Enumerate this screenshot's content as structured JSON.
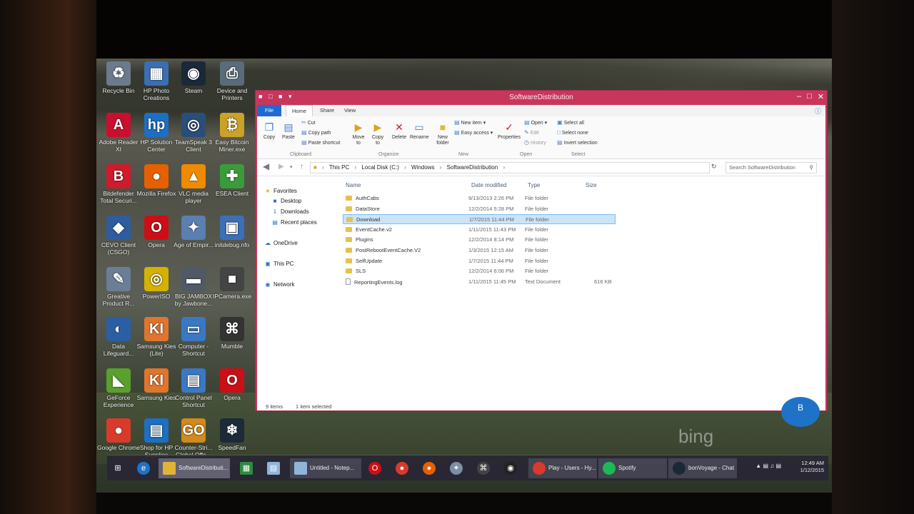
{
  "desktop": {
    "icons": [
      {
        "label": "Recycle Bin",
        "glyph": "♻",
        "color": "#6b7b8c"
      },
      {
        "label": "HP Photo Creations",
        "glyph": "▦",
        "color": "#3b6fb3"
      },
      {
        "label": "Steam",
        "glyph": "◉",
        "color": "#1b2838"
      },
      {
        "label": "Device and Printers",
        "glyph": "⎙",
        "color": "#5a6b7c"
      },
      {
        "label": "Adobe Reader XI",
        "glyph": "A",
        "color": "#c8102e"
      },
      {
        "label": "HP Solution Center",
        "glyph": "hp",
        "color": "#1d6fc2"
      },
      {
        "label": "TeamSpeak 3 Client",
        "glyph": "◎",
        "color": "#2a4e7a"
      },
      {
        "label": "Easy Bitcoin Miner.exe",
        "glyph": "₿",
        "color": "#c9a227"
      },
      {
        "label": "Bitdefender Total Securi...",
        "glyph": "B",
        "color": "#cf1b2b"
      },
      {
        "label": "Mozilla Firefox",
        "glyph": "●",
        "color": "#e66000"
      },
      {
        "label": "VLC media player",
        "glyph": "▲",
        "color": "#f08a00"
      },
      {
        "label": "ESEA Client",
        "glyph": "✚",
        "color": "#3a9b3a"
      },
      {
        "label": "CEVO Client (CSGO)",
        "glyph": "◆",
        "color": "#2f5c9e"
      },
      {
        "label": "Opera",
        "glyph": "O",
        "color": "#cc0f16"
      },
      {
        "label": "Age of Empir...",
        "glyph": "✦",
        "color": "#5a7fb0"
      },
      {
        "label": "initdebug.nfo",
        "glyph": "▣",
        "color": "#3c6fb8"
      },
      {
        "label": "Greative Product R...",
        "glyph": "✎",
        "color": "#6a7e95"
      },
      {
        "label": "PowerISO",
        "glyph": "◎",
        "color": "#d4b200"
      },
      {
        "label": "BIG JAMBOX by Jawbone...",
        "glyph": "▬",
        "color": "#505a66"
      },
      {
        "label": "IPCamera.exe",
        "glyph": "■",
        "color": "#444"
      },
      {
        "label": "Data Lifeguard...",
        "glyph": "◐",
        "color": "#2b5fa3"
      },
      {
        "label": "Samsung Kies (Lite)",
        "glyph": "KI",
        "color": "#e0752e"
      },
      {
        "label": "Computer - Shortcut",
        "glyph": "▭",
        "color": "#3b78c4"
      },
      {
        "label": "Mumble",
        "glyph": "⌘",
        "color": "#333"
      },
      {
        "label": "GeForce Experience",
        "glyph": "◣",
        "color": "#5aa02c"
      },
      {
        "label": "Samsung Kies",
        "glyph": "KI",
        "color": "#e0752e"
      },
      {
        "label": "Control Panel Shortcut",
        "glyph": "▤",
        "color": "#3b78c4"
      },
      {
        "label": "Opera",
        "glyph": "O",
        "color": "#cc0f16"
      },
      {
        "label": "Google Chrome",
        "glyph": "●",
        "color": "#d83b2b"
      },
      {
        "label": "Shop for HP Supplies",
        "glyph": "▤",
        "color": "#1d6fc2"
      },
      {
        "label": "Counter-Stri... Global Offe...",
        "glyph": "GO",
        "color": "#d18a1b"
      },
      {
        "label": "SpeedFan",
        "glyph": "❄",
        "color": "#1c2a3a"
      }
    ]
  },
  "window": {
    "title": "SoftwareDistribution",
    "controls": {
      "minimize": "–",
      "maximize": "□",
      "close": "✕"
    }
  },
  "ribbon": {
    "tabs": {
      "file": "File",
      "home": "Home",
      "share": "Share",
      "view": "View"
    },
    "clipboard": {
      "copy": "Copy",
      "paste": "Paste",
      "cut": "Cut",
      "copy_path": "Copy path",
      "paste_shortcut": "Paste shortcut",
      "group": "Clipboard"
    },
    "organize": {
      "move_to": "Move to",
      "copy_to": "Copy to",
      "delete": "Delete",
      "rename": "Rename",
      "group": "Organize"
    },
    "new": {
      "new_folder": "New folder",
      "new_item": "New item",
      "easy_access": "Easy access",
      "group": "New"
    },
    "open": {
      "properties": "Properties",
      "open": "Open",
      "edit": "Edit",
      "history": "History",
      "group": "Open"
    },
    "select": {
      "select_all": "Select all",
      "select_none": "Select none",
      "invert_selection": "Invert selection",
      "group": "Select"
    }
  },
  "address": {
    "crumbs": [
      "This PC",
      "Local Disk (C:)",
      "Windows",
      "SoftwareDistribution"
    ],
    "search_placeholder": "Search SoftwareDistribution"
  },
  "navpane": {
    "favorites": "Favorites",
    "desktop": "Desktop",
    "downloads": "Downloads",
    "recent": "Recent places",
    "onedrive": "OneDrive",
    "thispc": "This PC",
    "network": "Network"
  },
  "columns": {
    "name": "Name",
    "date": "Date modified",
    "type": "Type",
    "size": "Size"
  },
  "files": [
    {
      "name": "AuthCabs",
      "date": "9/13/2013 2:26 PM",
      "type": "File folder",
      "size": ""
    },
    {
      "name": "DataStore",
      "date": "12/2/2014 5:28 PM",
      "type": "File folder",
      "size": ""
    },
    {
      "name": "Download",
      "date": "1/7/2015 11:44 PM",
      "type": "File folder",
      "size": ""
    },
    {
      "name": "EventCache.v2",
      "date": "1/11/2015 11:43 PM",
      "type": "File folder",
      "size": ""
    },
    {
      "name": "Plugins",
      "date": "12/2/2014 8:14 PM",
      "type": "File folder",
      "size": ""
    },
    {
      "name": "PostRebootEventCache.V2",
      "date": "1/3/2015 12:15 AM",
      "type": "File folder",
      "size": ""
    },
    {
      "name": "SelfUpdate",
      "date": "1/7/2015 11:44 PM",
      "type": "File folder",
      "size": ""
    },
    {
      "name": "SLS",
      "date": "12/2/2014 6:06 PM",
      "type": "File folder",
      "size": ""
    },
    {
      "name": "ReportingEvents.log",
      "date": "1/11/2015 11:45 PM",
      "type": "Text Document",
      "size": "616 KB"
    }
  ],
  "selected_row": 2,
  "status": {
    "count": "9 items",
    "selection": "1 item selected"
  },
  "bing": "bing",
  "badge": "B",
  "taskbar": {
    "explorer": "SoftwareDistributi...",
    "notepad": "Untitled - Notep...",
    "chrome": "Play - Users - Hy...",
    "spotify": "Spotify",
    "steam_chat": "bonVoyage - Chat",
    "time": "12:49 AM",
    "date": "1/12/2015"
  }
}
